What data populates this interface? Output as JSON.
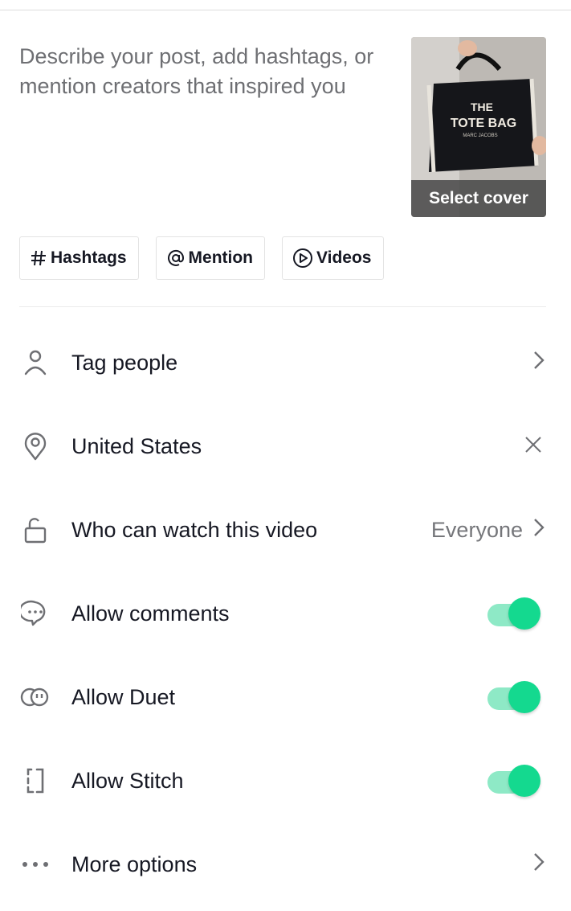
{
  "caption": {
    "placeholder": "Describe your post, add hashtags, or mention creators that inspired you"
  },
  "cover": {
    "label": "Select cover",
    "image_text_line1": "THE",
    "image_text_line2": "TOTE BAG",
    "image_text_line3": "MARC JACOBS"
  },
  "chips": [
    {
      "icon": "hashtag-icon",
      "label": "Hashtags"
    },
    {
      "icon": "at-icon",
      "label": "Mention"
    },
    {
      "icon": "play-circle-icon",
      "label": "Videos"
    }
  ],
  "settings": [
    {
      "icon": "person-icon",
      "label": "Tag people",
      "control": "chevron"
    },
    {
      "icon": "location-icon",
      "label": "United States",
      "control": "close"
    },
    {
      "icon": "unlock-icon",
      "label": "Who can watch this video",
      "control": "chevron",
      "value": "Everyone"
    },
    {
      "icon": "comment-icon",
      "label": "Allow comments",
      "control": "toggle",
      "on": true
    },
    {
      "icon": "duet-icon",
      "label": "Allow Duet",
      "control": "toggle",
      "on": true
    },
    {
      "icon": "stitch-icon",
      "label": "Allow Stitch",
      "control": "toggle",
      "on": true
    },
    {
      "icon": "more-icon",
      "label": "More options",
      "control": "chevron"
    }
  ],
  "colors": {
    "toggle_on": "#14d98f",
    "toggle_track": "#8ee9c6",
    "text_primary": "#161823",
    "text_secondary": "#75767a"
  }
}
